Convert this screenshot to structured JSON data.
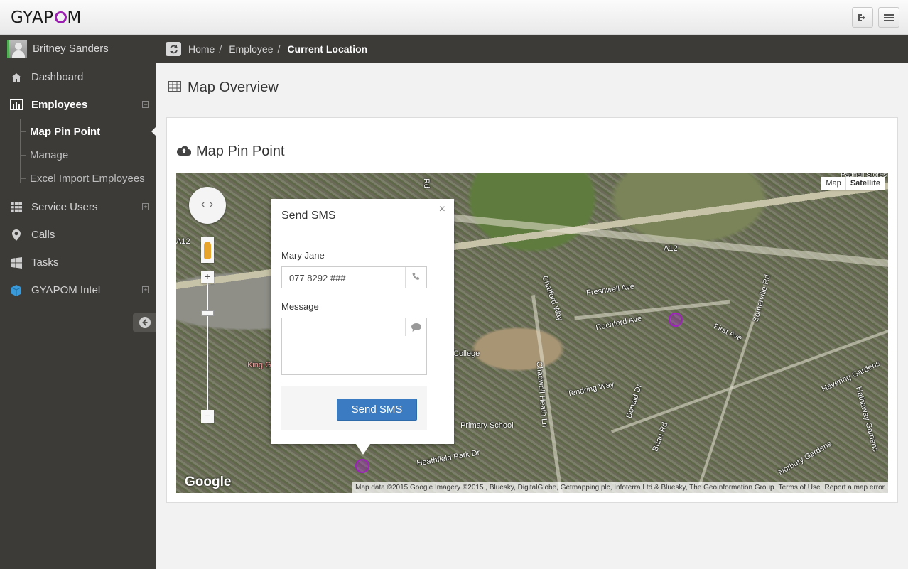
{
  "app": {
    "logo": "GYAPOM"
  },
  "header": {
    "logout_icon": "sign-out-icon",
    "menu_icon": "bars-icon"
  },
  "user": {
    "name": "Britney Sanders"
  },
  "sidebar": {
    "items": [
      {
        "label": "Dashboard",
        "icon": "home-icon"
      },
      {
        "label": "Employees",
        "icon": "bar-chart-icon",
        "toggle": "⊟"
      },
      {
        "label": "Service Users",
        "icon": "table-icon",
        "toggle": "⊞"
      },
      {
        "label": "Calls",
        "icon": "map-marker-icon"
      },
      {
        "label": "Tasks",
        "icon": "windows-icon"
      },
      {
        "label": "GYAPOM Intel",
        "icon": "cube-icon",
        "toggle": "⊞"
      }
    ],
    "employees_sub": [
      {
        "label": "Map Pin Point"
      },
      {
        "label": "Manage"
      },
      {
        "label": "Excel Import Employees"
      }
    ]
  },
  "breadcrumb": {
    "home": "Home",
    "employee": "Employee",
    "current": "Current Location",
    "sep": "/"
  },
  "page": {
    "title": "Map Overview"
  },
  "panel": {
    "title": "Map Pin Point"
  },
  "map": {
    "type_map": "Map",
    "type_satellite": "Satellite",
    "labels": [
      "A12",
      "A12",
      "Freshwell Ave",
      "Rochford Ave",
      "First Ave",
      "Somerville Rd",
      "Chadwell Heath Ln",
      "Tendring Way",
      "Donald Dr",
      "Brian Rd",
      "Havering Gardens",
      "Hathaway Gardens",
      "Norbury Gardens",
      "Heathfield Park Dr",
      "Primary School",
      "College",
      "King G",
      "Chatford Way",
      "Rd",
      "Padnall Stores"
    ],
    "google": "Google",
    "attribution": "Map data ©2015 Google Imagery ©2015 , Bluesky, DigitalGlobe, Getmapping plc, Infoterra Ltd & Bluesky, The GeoInformation Group",
    "terms": "Terms of Use",
    "report": "Report a map error"
  },
  "sms": {
    "title": "Send SMS",
    "close": "×",
    "contact_name": "Mary Jane",
    "phone_value": "077 8292 ###",
    "message_label": "Message",
    "message_value": "",
    "send_label": "Send SMS"
  }
}
